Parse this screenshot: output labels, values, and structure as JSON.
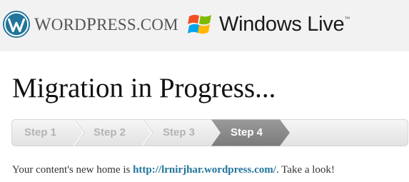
{
  "header": {
    "wordpress_logo_text_1": "W",
    "wordpress_logo_text_2": "ORD",
    "wordpress_logo_text_3": "P",
    "wordpress_logo_text_4": "RESS",
    "wordpress_logo_text_5": ".COM",
    "windows_live_logo_text": "Windows Live",
    "windows_live_tm": "™"
  },
  "main": {
    "title": "Migration in Progress...",
    "steps": [
      {
        "label": "Step 1",
        "state": "done"
      },
      {
        "label": "Step 2",
        "state": "done"
      },
      {
        "label": "Step 3",
        "state": "done"
      },
      {
        "label": "Step 4",
        "state": "active"
      }
    ],
    "message": {
      "prefix": "Your content's new home is ",
      "link_text": "http://lrnirjhar.wordpress.com/",
      "suffix": ". Take a look!"
    }
  },
  "colors": {
    "header_bg": "#f2f2f2",
    "link": "#21759b",
    "step_active": "#8a8a8a",
    "step_inactive": "#e9e9e9"
  },
  "icons": [
    "wordpress-logo-icon",
    "windows-flag-icon"
  ]
}
